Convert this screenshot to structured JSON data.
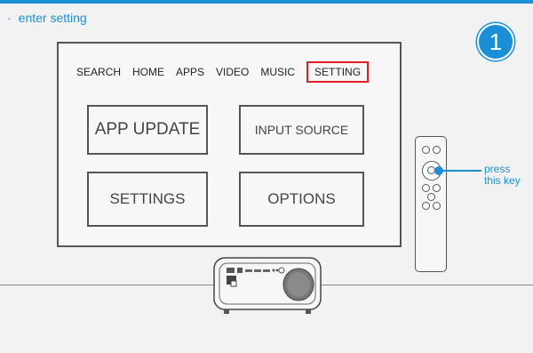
{
  "header": {
    "bullet": "·",
    "title": "enter setting"
  },
  "step": {
    "number": "1"
  },
  "menu": {
    "items": [
      "SEARCH",
      "HOME",
      "APPS",
      "VIDEO",
      "MUSIC"
    ],
    "active": "SETTING"
  },
  "tiles": {
    "app_update": "APP UPDATE",
    "input_source": "INPUT SOURCE",
    "settings": "SETTINGS",
    "options": "OPTIONS"
  },
  "callout": {
    "line1": "press",
    "line2": "this key"
  },
  "colors": {
    "accent": "#1a8fd6",
    "highlight": "#e02020"
  }
}
